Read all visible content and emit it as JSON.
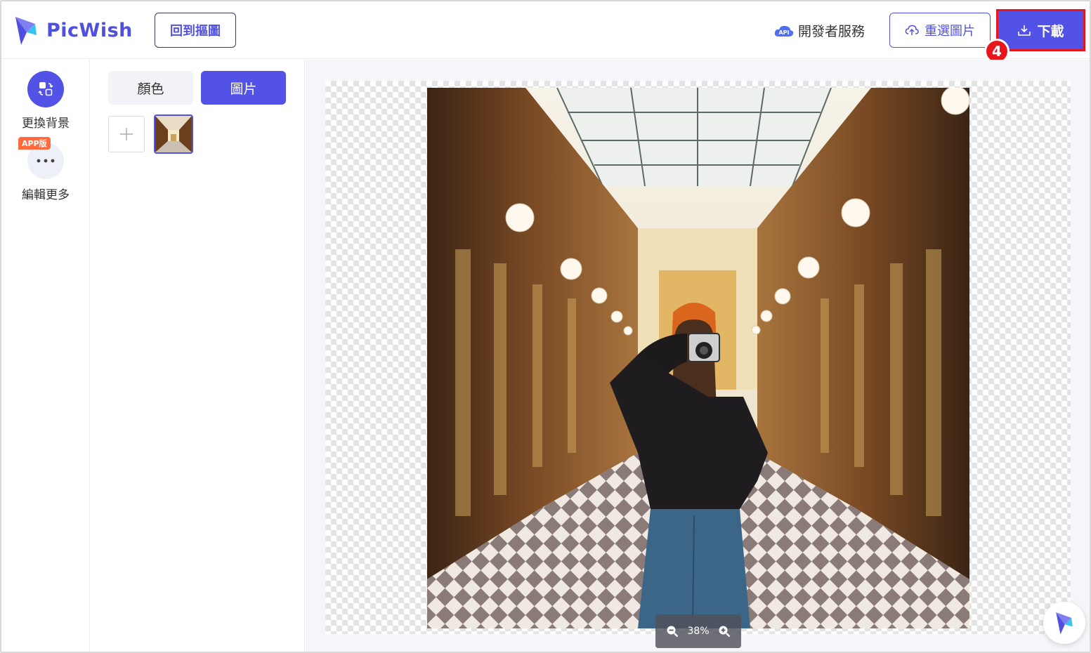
{
  "brand": {
    "name": "PicWish"
  },
  "header": {
    "back_label": "回到摳圖",
    "api_badge": "API",
    "api_label": "開發者服務",
    "reselect_label": "重選圖片",
    "download_label": "下載",
    "step_number": "4"
  },
  "rail": {
    "items": [
      {
        "label": "更換背景",
        "icon": "swap-background-icon"
      },
      {
        "label": "編輯更多",
        "icon": "more-icon",
        "tag": "APP版"
      }
    ]
  },
  "panel": {
    "tabs": [
      {
        "label": "顏色",
        "active": false
      },
      {
        "label": "圖片",
        "active": true
      }
    ]
  },
  "canvas": {
    "zoom": "38%"
  },
  "colors": {
    "accent": "#5252e6",
    "highlight": "#e8161c",
    "tag": "#ff6b3d"
  }
}
